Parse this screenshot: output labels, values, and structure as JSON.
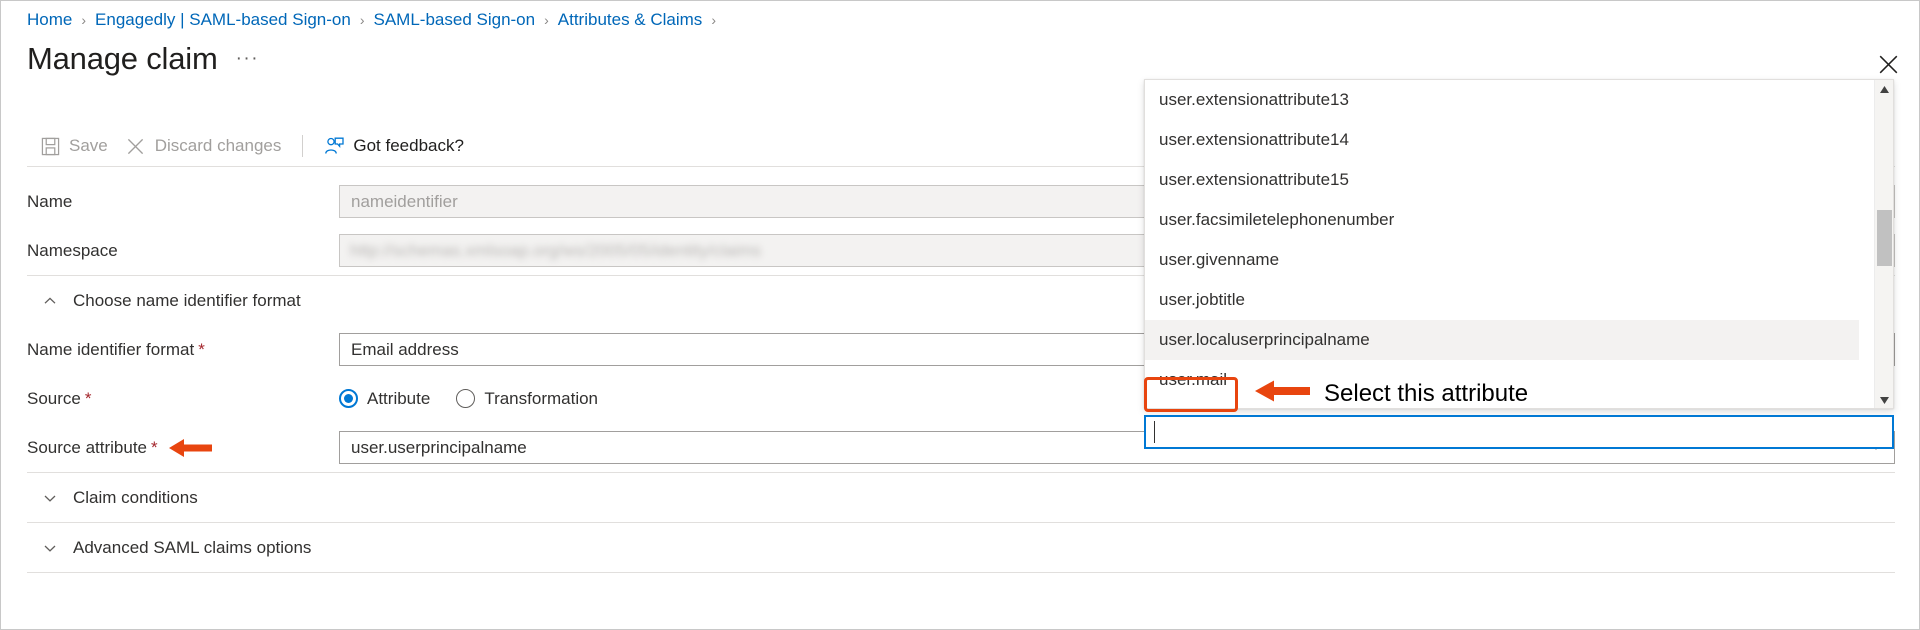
{
  "breadcrumb": {
    "items": [
      {
        "label": "Home"
      },
      {
        "label": "Engagedly | SAML-based Sign-on"
      },
      {
        "label": "SAML-based Sign-on"
      },
      {
        "label": "Attributes & Claims"
      }
    ],
    "separator": "›",
    "trailing_separator": "›"
  },
  "header": {
    "title": "Manage claim",
    "more_label": "···",
    "close_icon": "close-icon"
  },
  "toolbar": {
    "save_label": "Save",
    "save_icon": "save-icon",
    "save_enabled": false,
    "discard_label": "Discard changes",
    "discard_icon": "close-x-icon",
    "discard_enabled": false,
    "feedback_label": "Got feedback?",
    "feedback_icon": "feedback-person-icon",
    "feedback_enabled": true
  },
  "form": {
    "name": {
      "label": "Name",
      "value": "nameidentifier",
      "disabled": true
    },
    "namespace": {
      "label": "Namespace",
      "value": "http://schemas.xmlsoap.org/ws/2005/05/identity/claims",
      "redacted": true
    },
    "name_identifier_section": {
      "label": "Choose name identifier format",
      "expanded": true,
      "caret_icon": "chevron-up-icon"
    },
    "name_identifier_format": {
      "label": "Name identifier format",
      "required_mark": "*",
      "value": "Email address",
      "chevron_icon": "chevron-down-icon"
    },
    "source": {
      "label": "Source",
      "required_mark": "*",
      "options": [
        {
          "label": "Attribute",
          "selected": true
        },
        {
          "label": "Transformation",
          "selected": false
        }
      ]
    },
    "source_attribute": {
      "label": "Source attribute",
      "required_mark": "*",
      "value": "user.userprincipalname",
      "chevron_icon": "chevron-down-icon",
      "annotation_icon": "red-arrow-left-icon"
    },
    "claim_conditions": {
      "label": "Claim conditions",
      "expanded": false,
      "caret_icon": "chevron-down-icon"
    },
    "advanced_saml": {
      "label": "Advanced SAML claims options",
      "expanded": false,
      "caret_icon": "chevron-down-icon"
    }
  },
  "dropdown": {
    "items": [
      {
        "label": "user.extensionattribute13",
        "state": "normal"
      },
      {
        "label": "user.extensionattribute14",
        "state": "normal"
      },
      {
        "label": "user.extensionattribute15",
        "state": "normal"
      },
      {
        "label": "user.facsimiletelephonenumber",
        "state": "normal"
      },
      {
        "label": "user.givenname",
        "state": "normal"
      },
      {
        "label": "user.jobtitle",
        "state": "normal"
      },
      {
        "label": "user.localuserprincipalname",
        "state": "hover"
      },
      {
        "label": "user.mail",
        "state": "highlighted"
      }
    ],
    "search_value": "",
    "search_placeholder": "",
    "scroll_up_icon": "scroll-up-arrow-icon",
    "scroll_down_icon": "scroll-down-arrow-icon"
  },
  "annotations": {
    "select_attribute_text": "Select this attribute",
    "arrow_icon": "red-arrow-left-icon",
    "highlight_color": "#e8450f"
  }
}
